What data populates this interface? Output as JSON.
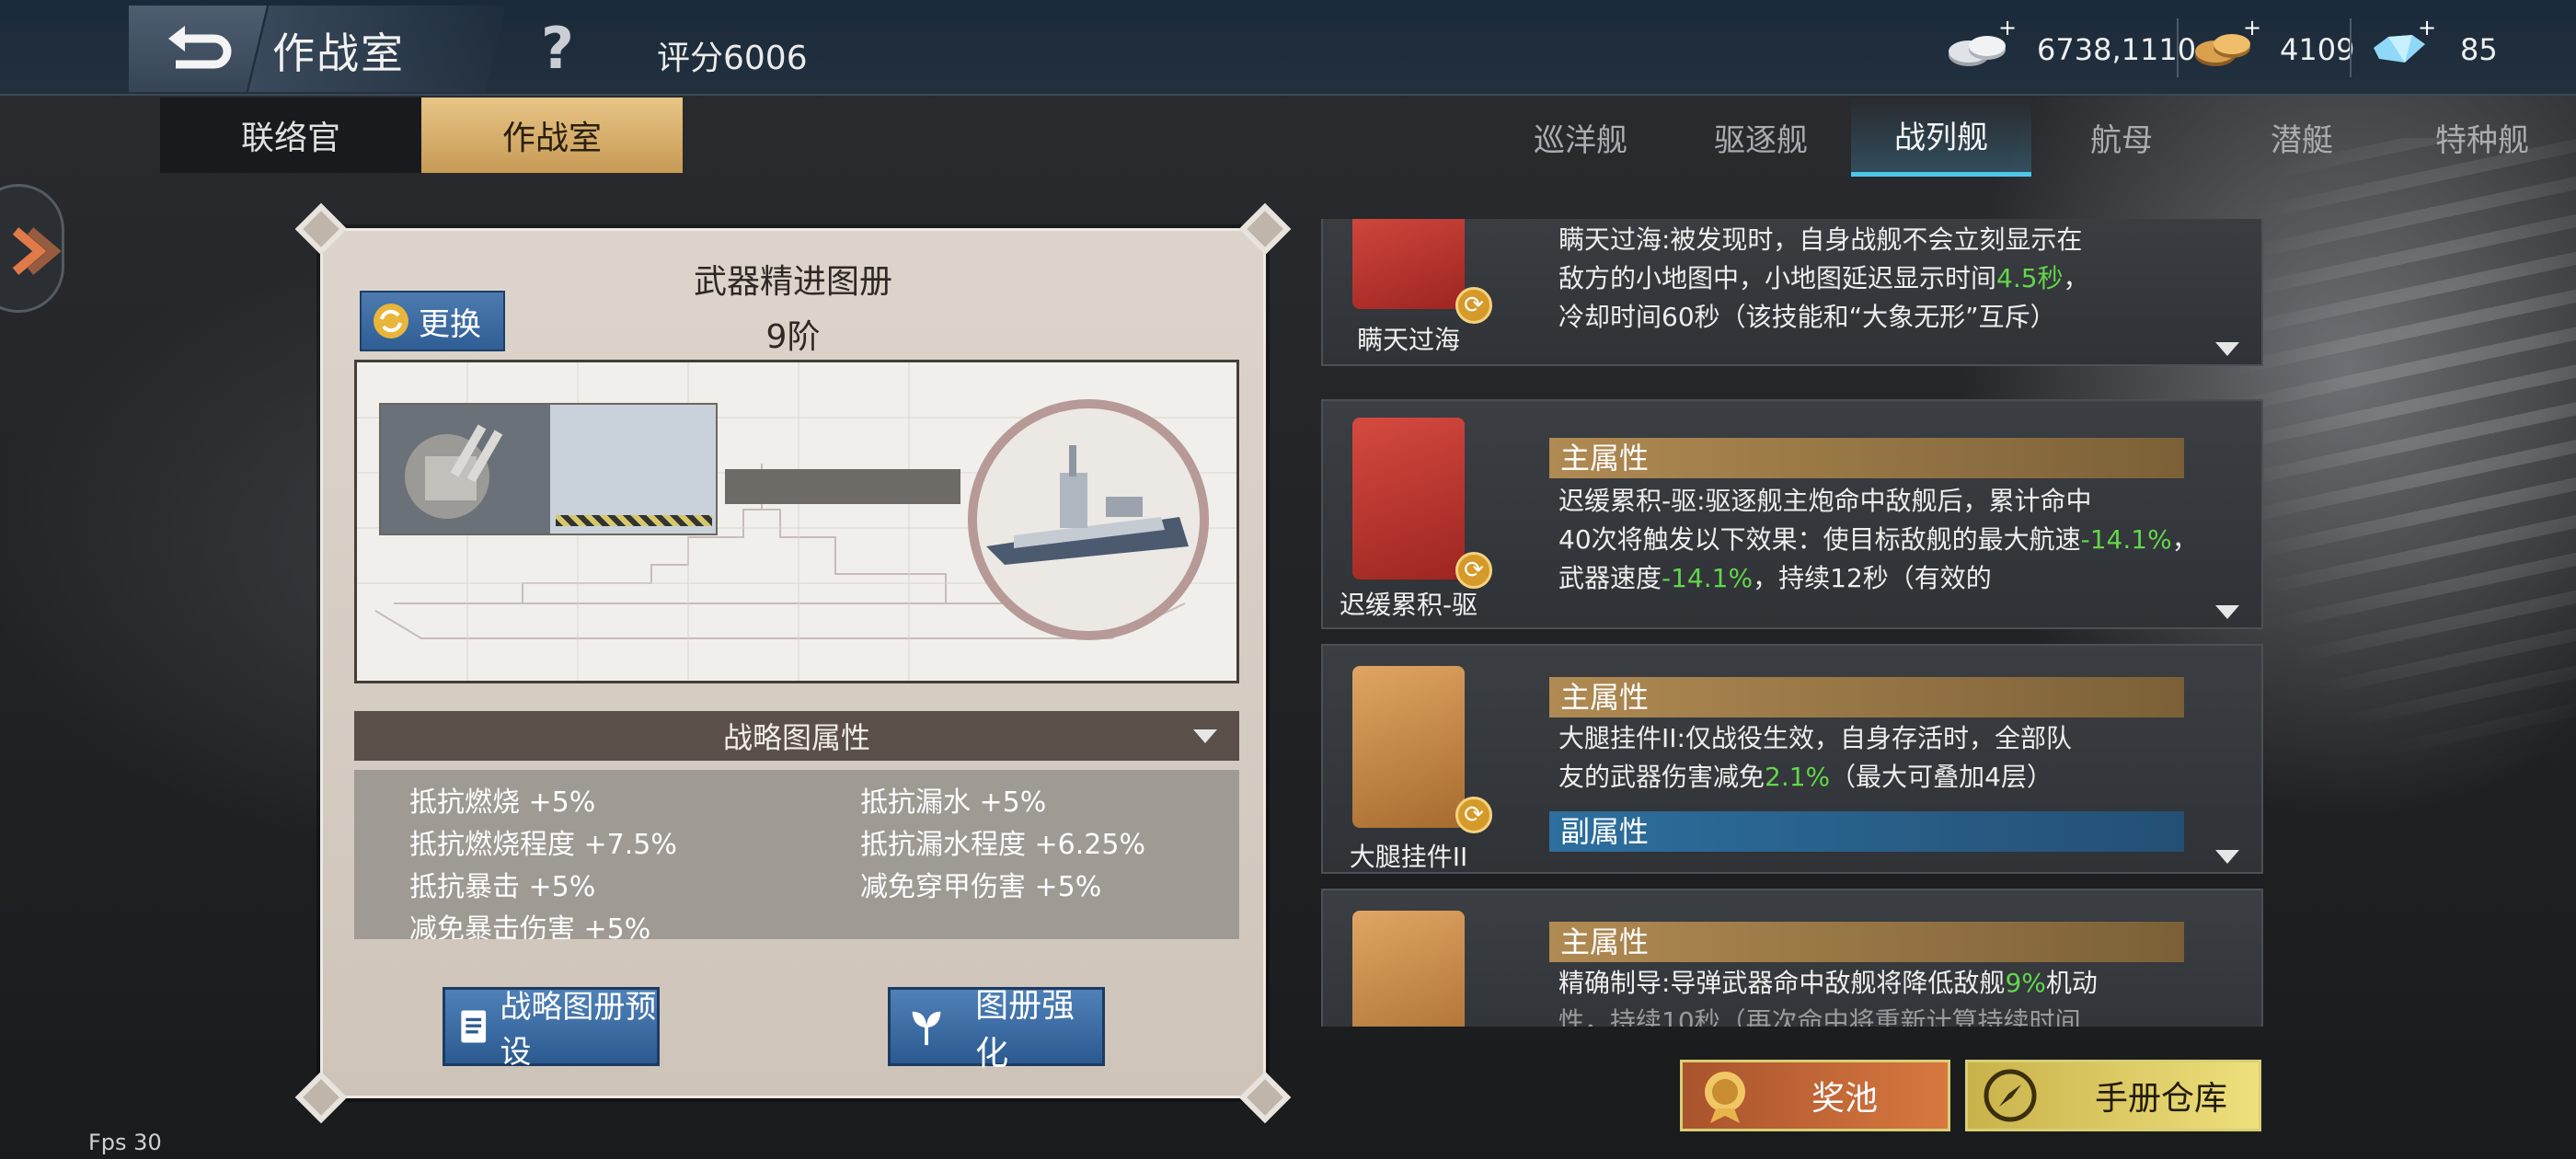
{
  "header": {
    "title": "作战室",
    "help_icon": "question-icon",
    "score": "评分6006"
  },
  "currencies": [
    {
      "name": "silver-coins-icon",
      "value": "6738,1110",
      "plus": "+"
    },
    {
      "name": "gold-coins-icon",
      "value": "4109",
      "plus": "+"
    },
    {
      "name": "diamond-icon",
      "value": "85",
      "plus": "+"
    }
  ],
  "subtabs": [
    {
      "label": "联络官",
      "active": false
    },
    {
      "label": "作战室",
      "active": true
    }
  ],
  "ship_tabs": [
    {
      "label": "巡洋舰"
    },
    {
      "label": "驱逐舰"
    },
    {
      "label": "战列舰",
      "active": true
    },
    {
      "label": "航母"
    },
    {
      "label": "潜艇"
    },
    {
      "label": "特种舰"
    }
  ],
  "panel": {
    "title": "武器精进图册",
    "level": "9阶",
    "swap_label": "更换",
    "stats_header": "战略图属性",
    "stats": [
      {
        "label": "抵抗燃烧 +5%"
      },
      {
        "label": "抵抗漏水 +5%"
      },
      {
        "label": "抵抗燃烧程度 +7.5%"
      },
      {
        "label": "抵抗漏水程度 +6.25%"
      },
      {
        "label": "抵抗暴击 +5%"
      },
      {
        "label": "减免穿甲伤害 +5%"
      },
      {
        "label": "减免暴击伤害 +5%"
      }
    ],
    "preset_label": "战略图册预设",
    "enhance_label": "图册强化"
  },
  "skills": [
    {
      "name": "瞒天过海",
      "desc": [
        "瞒天过海:被发现时，自身战舰不会立刻显示在",
        "敌方的小地图中，小地图延迟显示时间",
        "4.5秒",
        "，",
        "冷却时间60秒（该技能和“大象无形”互斥）"
      ]
    },
    {
      "name": "迟缓累积-驱",
      "main": "主属性",
      "desc": [
        "迟缓累积-驱:驱逐舰主炮命中敌舰后，累计命中",
        "40次将触发以下效果：使目标敌舰的最大航速",
        "-14.1%",
        "，武器速度",
        "-14.1%",
        "，持续12秒（有效的"
      ]
    },
    {
      "name": "大腿挂件II",
      "main": "主属性",
      "sub": "副属性",
      "desc": [
        "大腿挂件II:仅战役生效，自身存活时，全部队",
        "友的武器伤害减免",
        "2.1%",
        "（最大可叠加4层）"
      ]
    },
    {
      "name": "精确制导",
      "main": "主属性",
      "desc": [
        "精确制导:导弹武器命中敌舰将降低敌舰",
        "9%",
        "机动",
        "性，持续10秒（再次命中将重新计算持续时间"
      ]
    }
  ],
  "actions": {
    "prize_label": "奖池",
    "depot_label": "手册仓库"
  },
  "fps": "Fps 30",
  "colors": {
    "accent_gold": "#c79a55",
    "highlight_green": "#63d64b",
    "tab_active": "#4fc7e8"
  }
}
